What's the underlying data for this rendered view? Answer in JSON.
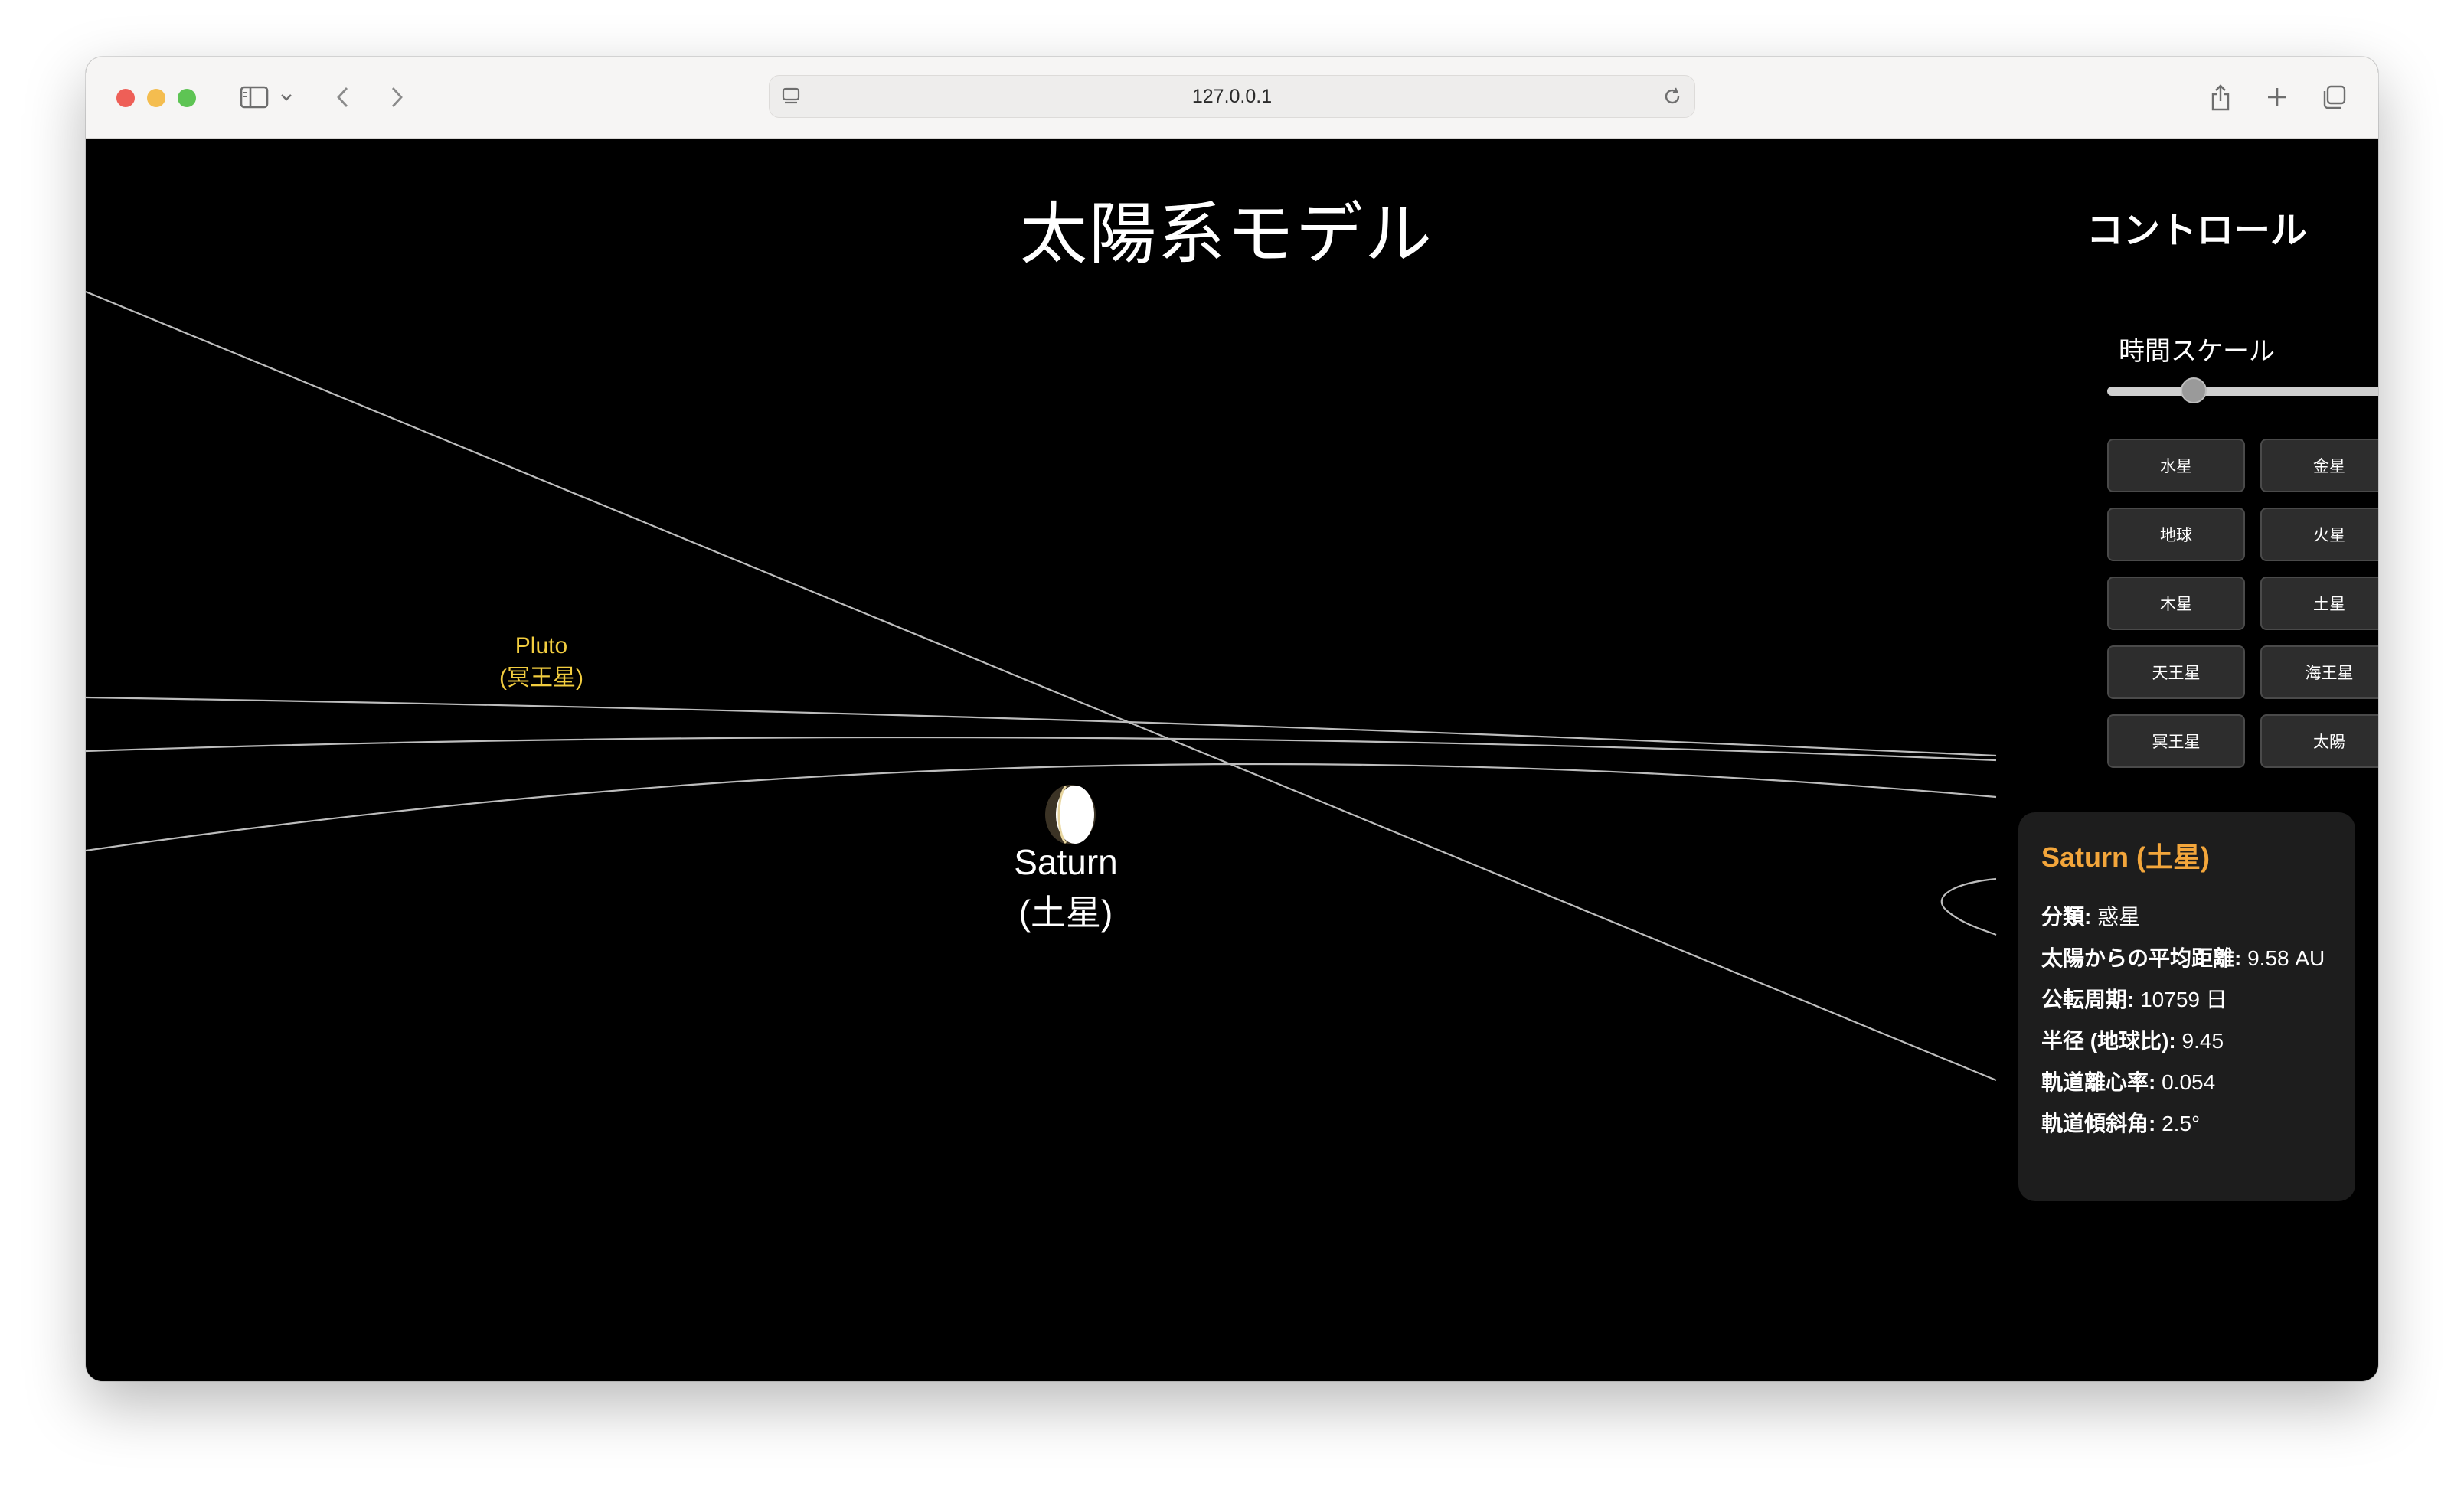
{
  "browser": {
    "url": "127.0.0.1"
  },
  "page": {
    "title": "太陽系モデル"
  },
  "scene": {
    "labels": {
      "pluto_name": "Pluto",
      "pluto_jp": "(冥王星)",
      "saturn_name": "Saturn",
      "saturn_jp": "(土星)"
    },
    "colors": {
      "pluto_label": "#f2cd3f",
      "orbit_line": "#bfbfbf",
      "background": "#000000"
    }
  },
  "controls": {
    "title": "コントロール",
    "time_scale_label": "時間スケール",
    "time_scale_value": 0.28,
    "buttons": [
      "水星",
      "金星",
      "地球",
      "火星",
      "木星",
      "土星",
      "天王星",
      "海王星",
      "冥王星",
      "太陽"
    ]
  },
  "info": {
    "title": "Saturn (土星)",
    "title_color": "#f3a63b",
    "rows": [
      {
        "key": "分類:",
        "value": "惑星"
      },
      {
        "key": "太陽からの平均距離:",
        "value": "9.58 AU"
      },
      {
        "key": "公転周期:",
        "value": "10759 日"
      },
      {
        "key": "半径 (地球比):",
        "value": "9.45"
      },
      {
        "key": "軌道離心率:",
        "value": "0.054"
      },
      {
        "key": "軌道傾斜角:",
        "value": "2.5°"
      }
    ]
  }
}
